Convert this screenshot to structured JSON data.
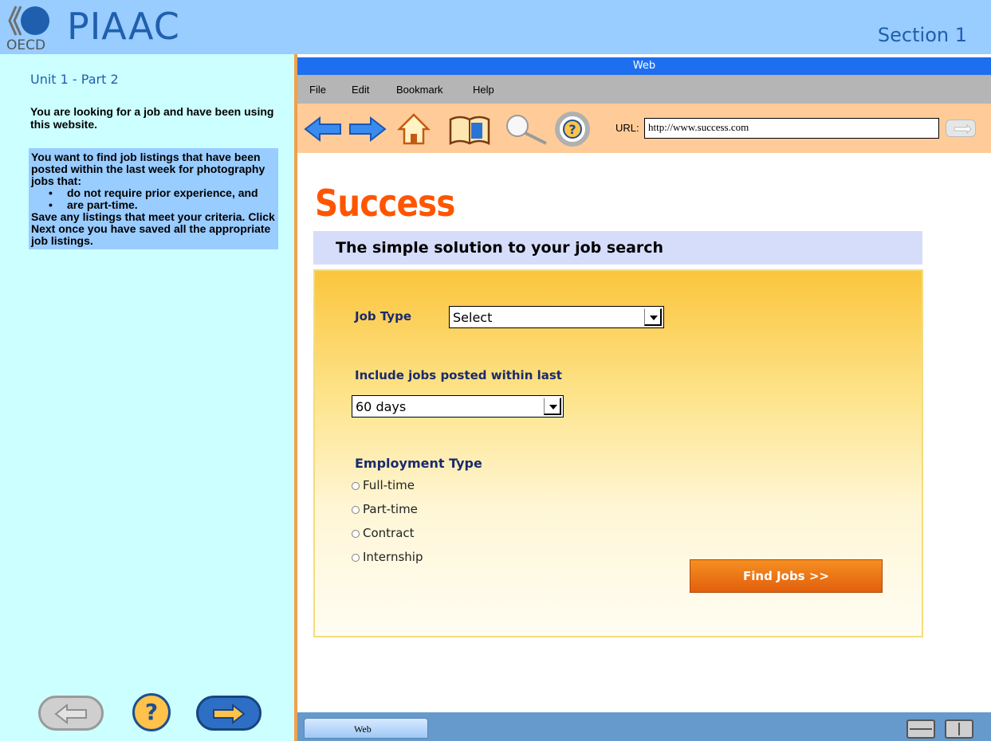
{
  "header": {
    "logo_text": "OECD",
    "brand": "PIAAC",
    "section": "Section 1"
  },
  "task_panel": {
    "unit_title": "Unit 1 - Part 2",
    "intro": "You are looking for a job and have been using this website.",
    "task_lines": [
      "You want to find job listings that have been posted within the last week for photography jobs that:"
    ],
    "bullets": [
      "do not require prior experience, and",
      "are part-time."
    ],
    "closing": "Save any listings that meet your criteria.  Click Next once you have saved all the appropriate job listings.",
    "help_label": "?"
  },
  "browser": {
    "title": "Web",
    "menu": {
      "file": "File",
      "edit": "Edit",
      "bookmark": "Bookmark",
      "help": "Help"
    },
    "toolbar": {
      "url_label": "URL:",
      "url_value": "http://www.success.com",
      "icons": [
        "back-arrow-icon",
        "forward-arrow-icon",
        "home-icon",
        "bookmark-book-icon",
        "search-magnifier-icon",
        "help-lifebuoy-icon",
        "go-arrow-icon"
      ]
    },
    "taskbar": {
      "tab_label": "Web"
    }
  },
  "site": {
    "logo": "Success",
    "tagline": "The simple solution to your job search",
    "job_type_label": "Job Type",
    "job_type_value": "Select",
    "posted_label": "Include jobs posted within last",
    "posted_value": "60 days",
    "employment_label": "Employment Type",
    "employment_options": [
      "Full-time",
      "Part-time",
      "Contract",
      "Internship"
    ],
    "find_button": "Find Jobs >>"
  },
  "colors": {
    "header_bg": "#99ccff",
    "panel_bg": "#ccffff",
    "titlebar": "#1e6fef",
    "toolbar_bg": "#ffcc99",
    "site_logo": "#ff5500",
    "button_orange": "#f58f22"
  }
}
